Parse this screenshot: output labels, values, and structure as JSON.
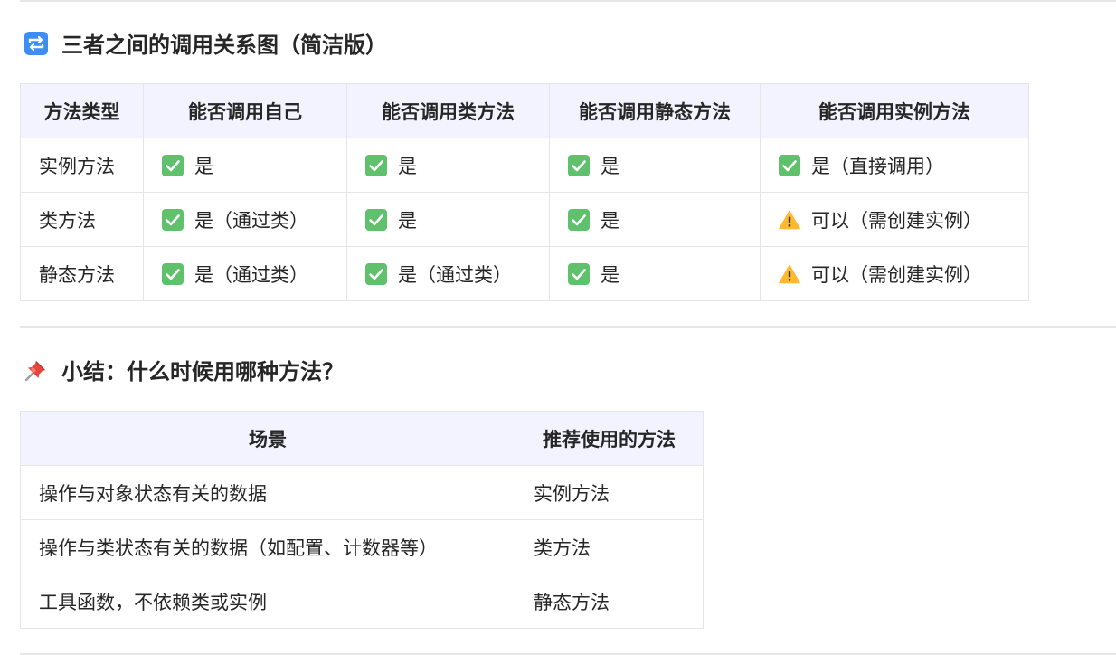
{
  "section1": {
    "icon": "repeat-arrows-icon",
    "title": "三者之间的调用关系图（简洁版）"
  },
  "table1": {
    "headers": [
      "方法类型",
      "能否调用自己",
      "能否调用类方法",
      "能否调用静态方法",
      "能否调用实例方法"
    ],
    "rows": [
      {
        "label": "实例方法",
        "cells": [
          {
            "icon": "check-mark-icon",
            "text": "是"
          },
          {
            "icon": "check-mark-icon",
            "text": "是"
          },
          {
            "icon": "check-mark-icon",
            "text": "是"
          },
          {
            "icon": "check-mark-icon",
            "text": "是（直接调用）"
          }
        ]
      },
      {
        "label": "类方法",
        "cells": [
          {
            "icon": "check-mark-icon",
            "text": "是（通过类）"
          },
          {
            "icon": "check-mark-icon",
            "text": "是"
          },
          {
            "icon": "check-mark-icon",
            "text": "是"
          },
          {
            "icon": "warning-icon",
            "text": "可以（需创建实例）"
          }
        ]
      },
      {
        "label": "静态方法",
        "cells": [
          {
            "icon": "check-mark-icon",
            "text": "是（通过类）"
          },
          {
            "icon": "check-mark-icon",
            "text": "是（通过类）"
          },
          {
            "icon": "check-mark-icon",
            "text": "是"
          },
          {
            "icon": "warning-icon",
            "text": "可以（需创建实例）"
          }
        ]
      }
    ]
  },
  "section2": {
    "icon": "pushpin-icon",
    "title": "小结：什么时候用哪种方法？"
  },
  "table2": {
    "headers": [
      "场景",
      "推荐使用的方法"
    ],
    "rows": [
      [
        "操作与对象状态有关的数据",
        "实例方法"
      ],
      [
        "操作与类状态有关的数据（如配置、计数器等）",
        "类方法"
      ],
      [
        "工具函数，不依赖类或实例",
        "静态方法"
      ]
    ]
  },
  "colors": {
    "header_bg": "#f2f3fe",
    "border": "#e6e6e6",
    "check_green": "#5fc16c",
    "warning_yellow": "#ffb92e",
    "repeat_blue": "#3d8ef2",
    "pin_red": "#e8453c"
  }
}
